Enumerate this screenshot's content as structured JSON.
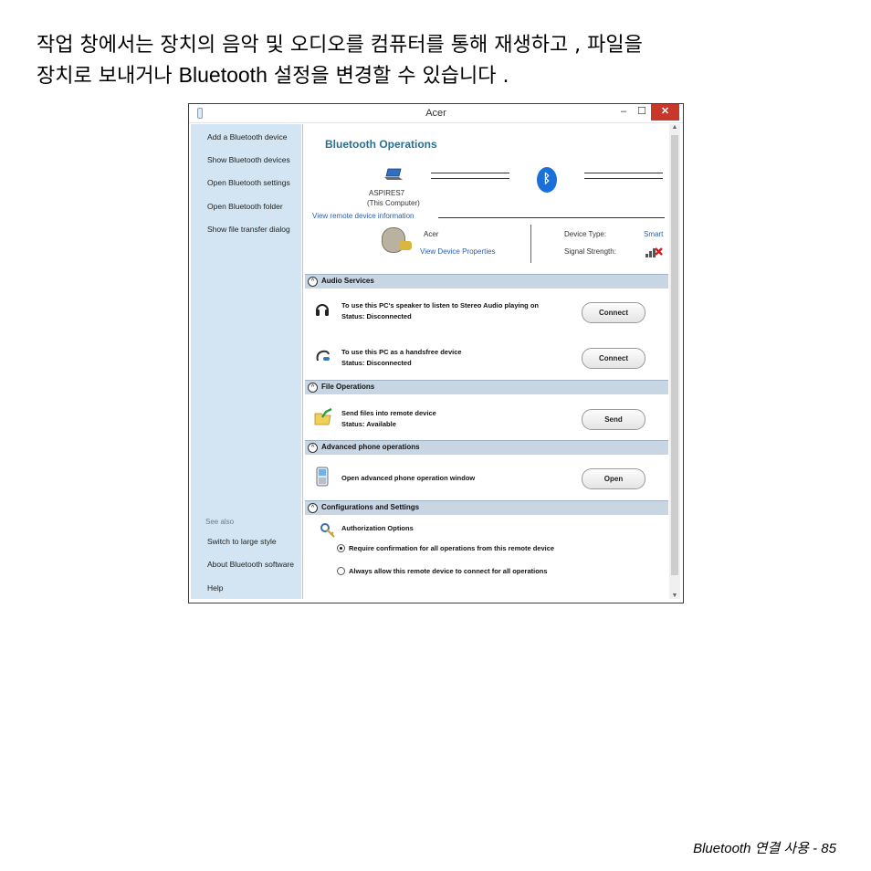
{
  "intro": {
    "line1": "작업 창에서는 장치의 음악 및 오디오를 컴퓨터를 통해 재생하고 , 파일을",
    "line2_pre": "장치로 보내거나 ",
    "line2_en": "Bluetooth",
    "line2_post": " 설정을 변경할 수 있습니다 ."
  },
  "window": {
    "title": "Acer",
    "min": "–",
    "max": "☐",
    "close": "✕"
  },
  "sidebar": {
    "items": [
      {
        "label": "Add a Bluetooth device"
      },
      {
        "label": "Show Bluetooth devices"
      },
      {
        "label": "Open Bluetooth settings"
      },
      {
        "label": "Open Bluetooth folder"
      },
      {
        "label": "Show file transfer dialog"
      }
    ],
    "see_also": "See also",
    "extra": [
      {
        "label": "Switch to large style"
      },
      {
        "label": "About Bluetooth software"
      },
      {
        "label": "Help"
      }
    ]
  },
  "main": {
    "heading": "Bluetooth Operations",
    "computer_name": "ASPIRES7",
    "computer_sub": "(This Computer)",
    "view_remote": "View remote device information",
    "remote_name": "Acer",
    "view_props": "View Device Properties",
    "device_type_label": "Device Type:",
    "device_type_value": "Smart",
    "signal_label": "Signal Strength:"
  },
  "sections": {
    "audio": {
      "title": "Audio Services",
      "row1_text": "To use this PC's speaker to listen to Stereo Audio playing on",
      "row1_status": "Status:   Disconnected",
      "row1_btn": "Connect",
      "row2_text": "To use this PC as a handsfree device",
      "row2_status": "Status:   Disconnected",
      "row2_btn": "Connect"
    },
    "files": {
      "title": "File Operations",
      "row_text": "Send files into remote device",
      "row_status": "Status:   Available",
      "row_btn": "Send"
    },
    "phone": {
      "title": "Advanced phone operations",
      "row_text": "Open advanced phone operation window",
      "row_btn": "Open"
    },
    "config": {
      "title": "Configurations and Settings",
      "auth": "Authorization Options",
      "opt1": "Require confirmation for all operations from this remote device",
      "opt2": "Always allow this remote device to connect for all operations"
    }
  },
  "footer": {
    "text": "Bluetooth 연결 사용 -  85"
  },
  "colors": {
    "sidebar_bg": "#d3e5f2",
    "section_bar": "#c8d6e4",
    "heading": "#2a6f8e",
    "link": "#2b5da8",
    "close": "#c7372a"
  }
}
